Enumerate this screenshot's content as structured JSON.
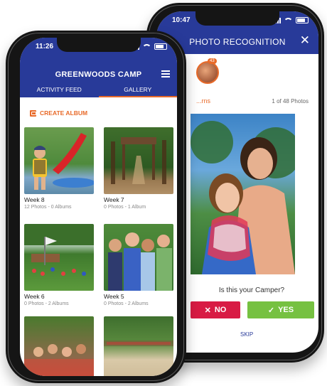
{
  "recognition_screen": {
    "status_time": "10:47",
    "title": "PHOTO RECOGNITION",
    "close_icon": "close-icon",
    "face_badge": "43",
    "name_label": "...rns",
    "photo_counter": "1 of 48 Photos",
    "question": "Is this your Camper?",
    "no_label": "NO",
    "yes_label": "YES",
    "skip_label": "SKIP"
  },
  "gallery_screen": {
    "status_time": "11:26",
    "title": "GREENWOODS CAMP",
    "tabs": [
      {
        "label": "ACTIVITY FEED"
      },
      {
        "label": "GALLERY"
      }
    ],
    "active_tab": "GALLERY",
    "create_album_label": "CREATE ALBUM",
    "albums": [
      {
        "name": "Week 8",
        "meta": "12 Photos - 0 Albums"
      },
      {
        "name": "Week 7",
        "meta": "0 Photos - 1 Album"
      },
      {
        "name": "Week 6",
        "meta": "0 Photos - 2 Albums"
      },
      {
        "name": "Week 5",
        "meta": "0 Photos - 2 Albums"
      }
    ]
  },
  "colors": {
    "header_blue": "#283a99",
    "accent_orange": "#e86a29",
    "no_red": "#d81b44",
    "yes_green": "#76c141"
  }
}
